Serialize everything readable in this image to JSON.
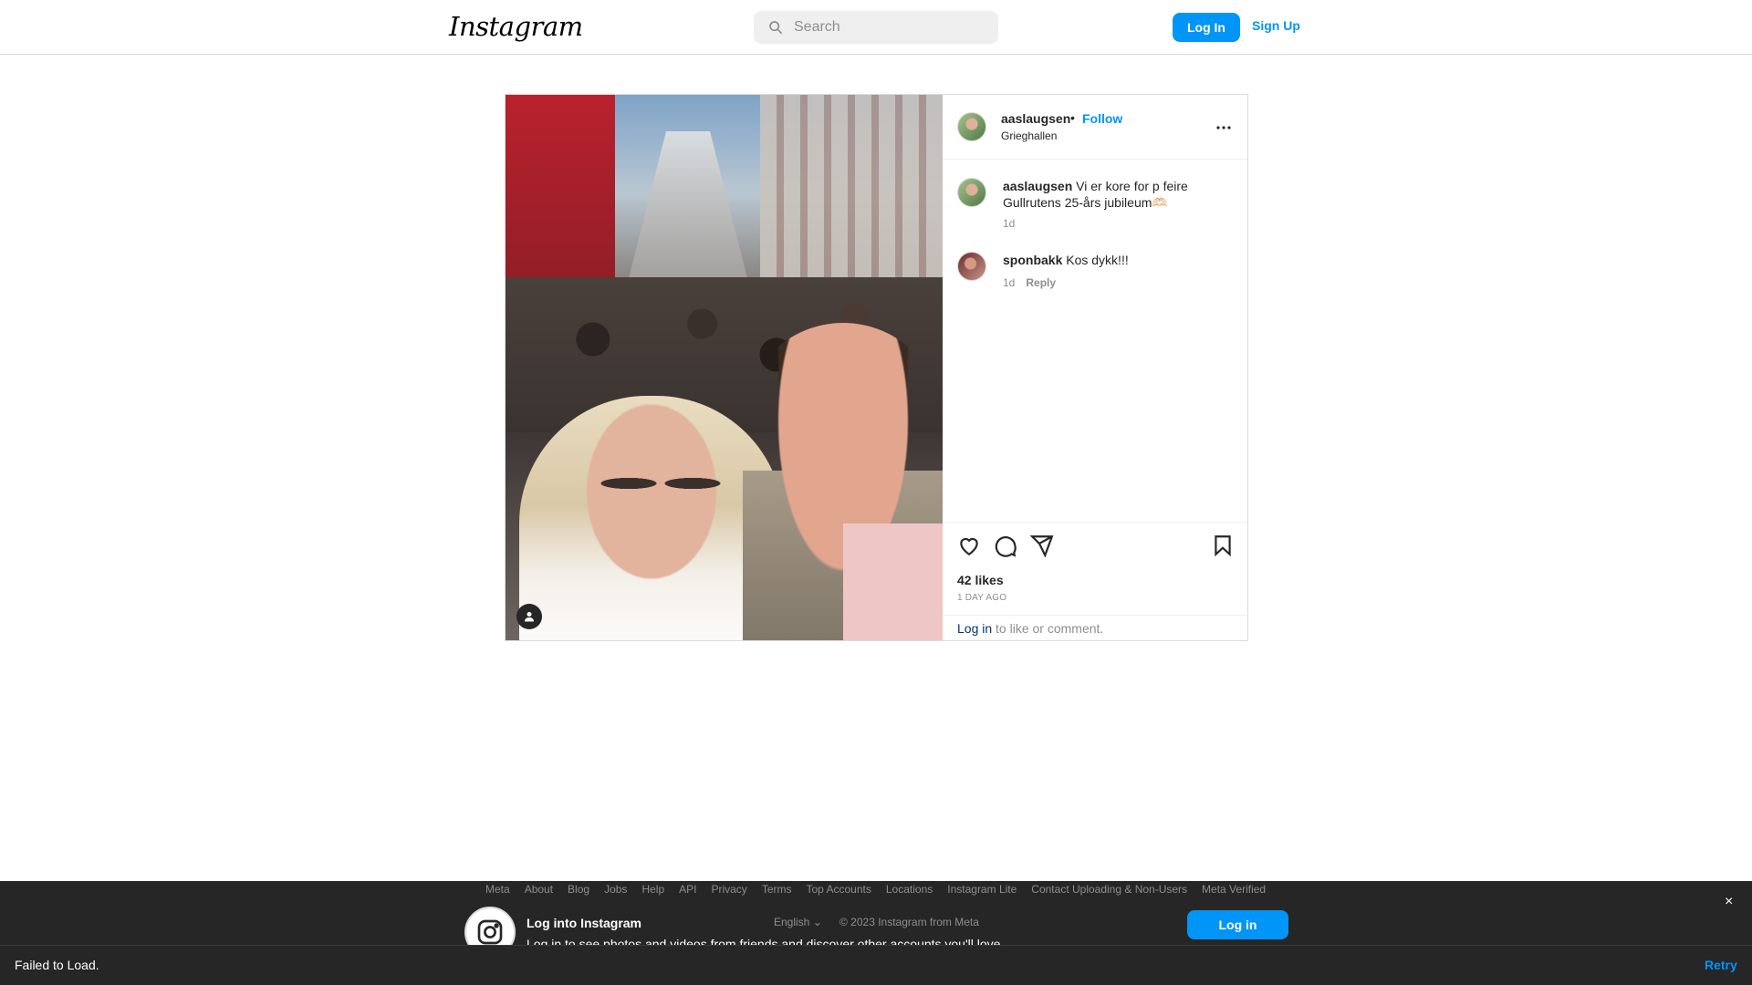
{
  "nav": {
    "logo_text": "Instagram",
    "search_placeholder": "Search",
    "login_label": "Log In",
    "signup_label": "Sign Up"
  },
  "post": {
    "author": "aaslaugsen",
    "separator": "•",
    "follow_label": "Follow",
    "location": "Grieghallen",
    "comments": [
      {
        "user": "aaslaugsen",
        "text": "Vi er kore for p feire Gullrutens 25-års jubileum🫶🏻",
        "time": "1d",
        "reply": ""
      },
      {
        "user": "sponbakk",
        "text": "Kos dykk!!!",
        "time": "1d",
        "reply": "Reply"
      }
    ],
    "likes": "42 likes",
    "time_ago": "1 DAY AGO",
    "login_link": "Log in",
    "login_suffix": " to like or comment."
  },
  "footer": {
    "links": [
      "Meta",
      "About",
      "Blog",
      "Jobs",
      "Help",
      "API",
      "Privacy",
      "Terms",
      "Top Accounts",
      "Locations",
      "Instagram Lite",
      "Contact Uploading & Non-Users",
      "Meta Verified"
    ],
    "language": "English",
    "copyright": "© 2023 Instagram from Meta"
  },
  "banner": {
    "title": "Log into Instagram",
    "subtitle": "Log in to see photos and videos from friends and discover other accounts you'll love.",
    "login_label": "Log in",
    "close_label": "×"
  },
  "status": {
    "message": "Failed to Load.",
    "retry_label": "Retry"
  },
  "colors": {
    "accent": "#0095f6",
    "banner_bg": "#262626"
  }
}
